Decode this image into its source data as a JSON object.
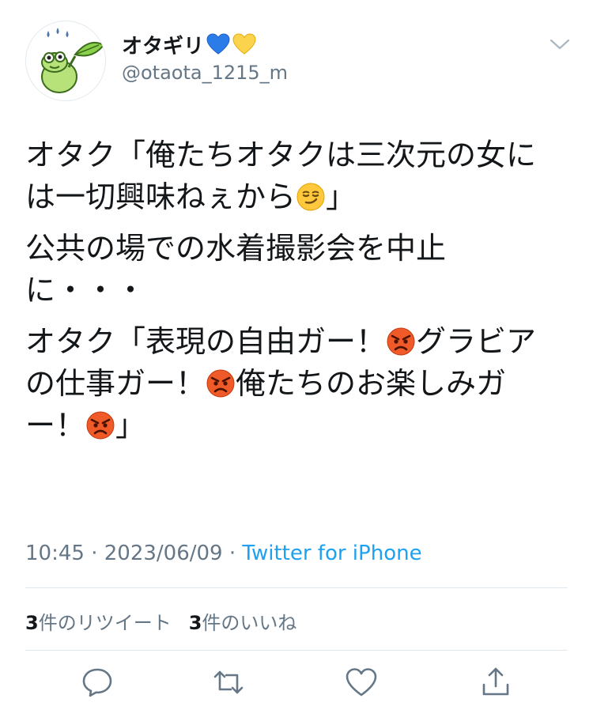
{
  "user": {
    "display_name": "オタギリ",
    "handle": "@otaota_1215_m"
  },
  "tweet": {
    "paragraphs": [
      {
        "text_before": "オタク「俺たちオタクは三次元の女には一切興味ねぇから",
        "emoji": "smirking-face",
        "text_after": "」"
      },
      {
        "text": "公共の場での水着撮影会を中止に・・・"
      },
      {
        "parts": [
          "オタク「表現の自由ガー！",
          "グラビアの仕事ガー！",
          "俺たちのお楽しみガー！",
          "」"
        ],
        "emoji": "angry-face"
      }
    ]
  },
  "meta": {
    "time": "10:45",
    "separator": " · ",
    "date": "2023/06/09",
    "source": "Twitter for iPhone"
  },
  "stats": {
    "retweets_count": "3",
    "retweets_label": "件のリツイート",
    "likes_count": "3",
    "likes_label": "件のいいね"
  },
  "icons": [
    "chevron-down-icon",
    "blue-heart-icon",
    "yellow-heart-icon",
    "smirking-face-icon",
    "angry-face-icon",
    "reply-icon",
    "retweet-icon",
    "like-icon",
    "share-icon"
  ],
  "colors": {
    "accent_link": "#1da1f2",
    "secondary_text": "#657786",
    "primary_text": "#14171a",
    "divider": "#e1e8ed"
  }
}
